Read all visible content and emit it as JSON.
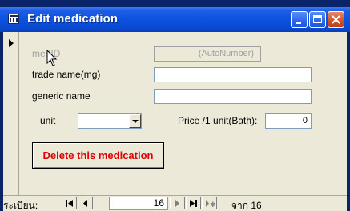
{
  "window": {
    "title": "Edit medication"
  },
  "form": {
    "med_id": {
      "label": "medID",
      "value": "(AutoNumber)"
    },
    "trade_name": {
      "label": "trade name(mg)",
      "value": ""
    },
    "generic_name": {
      "label": "generic name",
      "value": ""
    },
    "unit": {
      "label": "unit",
      "value": ""
    },
    "price": {
      "label": "Price /1 unit(Bath):",
      "value": "0"
    },
    "delete_label": "Delete this medication"
  },
  "navigator": {
    "record_label": "ระเบียน:",
    "current": "16",
    "of_label": "จาก 16"
  },
  "icons": {
    "title": "form-icon",
    "first": "first-record-icon",
    "prev": "previous-record-icon",
    "next": "next-record-icon",
    "last": "last-record-icon",
    "new": "new-record-icon"
  },
  "colors": {
    "title_bar": "#0b52e0",
    "client_bg": "#ece9d8",
    "delete_text": "#e00000"
  }
}
